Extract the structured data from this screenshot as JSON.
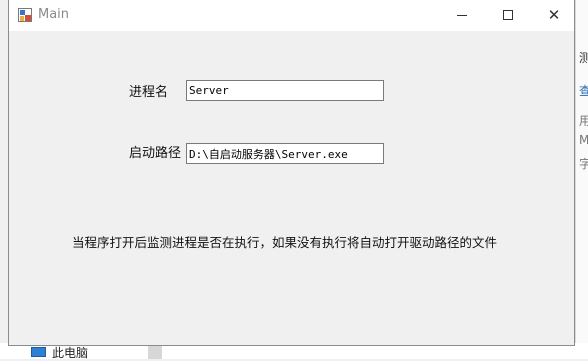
{
  "window": {
    "title": "Main",
    "close_glyph": "✕"
  },
  "form": {
    "process_name_label": "进程名",
    "process_name_value": "Server",
    "start_path_label": "启动路径",
    "start_path_value": "D:\\自启动服务器\\Server.exe",
    "description": "当程序打开后监测进程是否在执行，如果没有执行将自动打开驱动路径的文件"
  },
  "background": {
    "right_glyphs": [
      "测",
      "查",
      "用",
      "ML",
      "字"
    ],
    "bottom_item_label": "此电脑"
  },
  "colors": {
    "window_bg": "#f0f0f0",
    "titlebar_bg": "#ffffff",
    "title_text": "#8a8a8a",
    "input_border": "#7a7a7a"
  },
  "icons": {
    "app": "winforms-app-icon",
    "minimize": "minimize-icon",
    "maximize": "maximize-icon",
    "close": "close-icon",
    "computer": "computer-icon"
  }
}
